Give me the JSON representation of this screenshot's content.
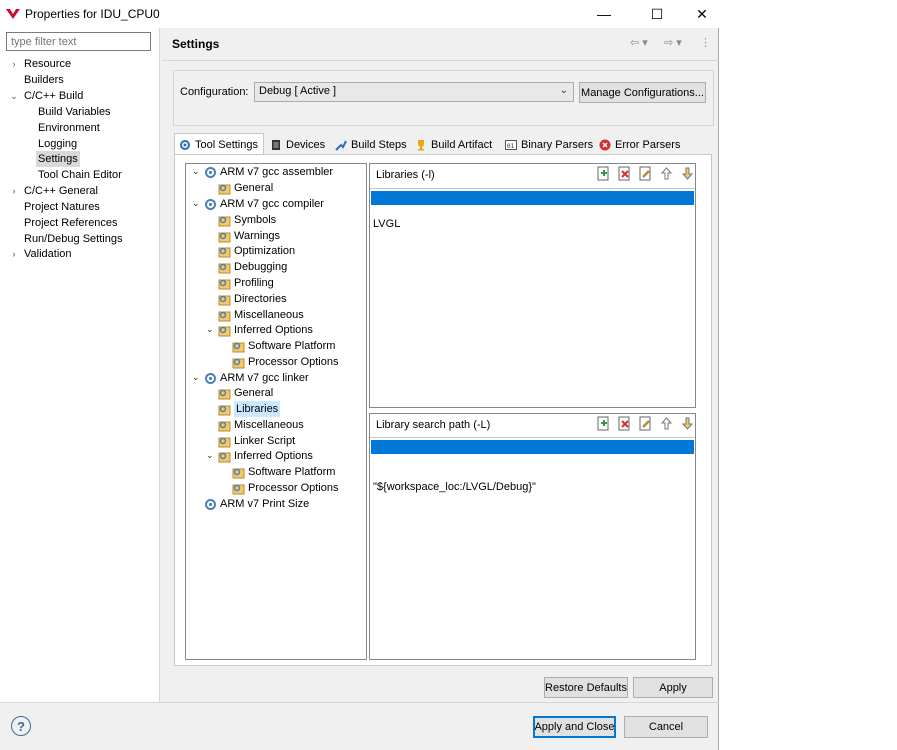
{
  "window": {
    "title": "Properties for IDU_CPU0",
    "minimize": "—",
    "maximize": "☐",
    "close": "✕"
  },
  "filter": {
    "placeholder": "type filter text"
  },
  "nav": {
    "items": [
      {
        "label": "Resource"
      },
      {
        "label": "Builders"
      },
      {
        "label": "C/C++ Build"
      },
      {
        "label": "Build Variables"
      },
      {
        "label": "Environment"
      },
      {
        "label": "Logging"
      },
      {
        "label": "Settings"
      },
      {
        "label": "Tool Chain Editor"
      },
      {
        "label": "C/C++ General"
      },
      {
        "label": "Project Natures"
      },
      {
        "label": "Project References"
      },
      {
        "label": "Run/Debug Settings"
      },
      {
        "label": "Validation"
      }
    ]
  },
  "page": {
    "title": "Settings"
  },
  "config": {
    "label": "Configuration:",
    "value": "Debug  [ Active ]",
    "manage_button": "Manage Configurations..."
  },
  "tabs": [
    {
      "label": "Tool Settings"
    },
    {
      "label": "Devices"
    },
    {
      "label": "Build Steps"
    },
    {
      "label": "Build Artifact"
    },
    {
      "label": "Binary Parsers"
    },
    {
      "label": "Error Parsers"
    }
  ],
  "tree": {
    "nodes": [
      {
        "label": "ARM v7 gcc assembler"
      },
      {
        "label": "General"
      },
      {
        "label": "ARM v7 gcc compiler"
      },
      {
        "label": "Symbols"
      },
      {
        "label": "Warnings"
      },
      {
        "label": "Optimization"
      },
      {
        "label": "Debugging"
      },
      {
        "label": "Profiling"
      },
      {
        "label": "Directories"
      },
      {
        "label": "Miscellaneous"
      },
      {
        "label": "Inferred Options"
      },
      {
        "label": "Software Platform"
      },
      {
        "label": "Processor Options"
      },
      {
        "label": "ARM v7 gcc linker"
      },
      {
        "label": "General"
      },
      {
        "label": "Libraries"
      },
      {
        "label": "Miscellaneous"
      },
      {
        "label": "Linker Script"
      },
      {
        "label": "Inferred Options"
      },
      {
        "label": "Software Platform"
      },
      {
        "label": "Processor Options"
      },
      {
        "label": "ARM v7 Print Size"
      }
    ]
  },
  "libraries": {
    "title": "Libraries (-l)",
    "rows": [
      "",
      "",
      "LVGL",
      "",
      "",
      "",
      "",
      ""
    ]
  },
  "libpath": {
    "title": "Library search path (-L)",
    "rows": [
      "",
      "",
      "",
      "\"${workspace_loc:/LVGL/Debug}\"",
      "",
      "",
      "",
      ""
    ]
  },
  "buttons": {
    "restore_defaults": "Restore Defaults",
    "apply": "Apply",
    "apply_close": "Apply and Close",
    "cancel": "Cancel"
  },
  "help": {
    "label": "?"
  },
  "colors": {
    "selection": "#0078d7",
    "tree_selection": "#cce8ff",
    "accent": "#0078d7"
  }
}
